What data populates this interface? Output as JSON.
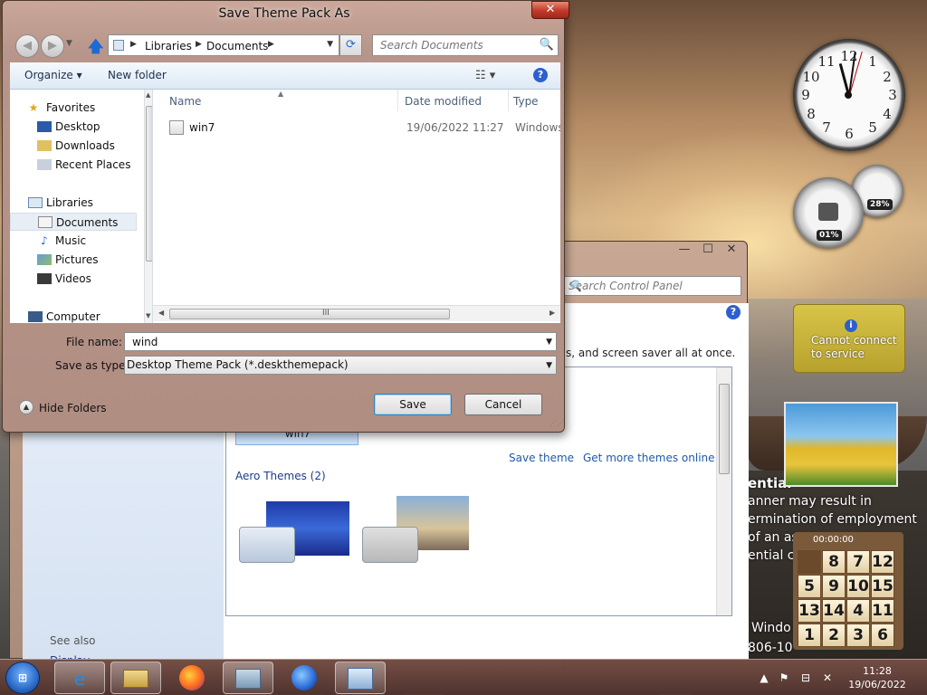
{
  "dialog": {
    "title": "Save Theme Pack As",
    "close_glyph": "✕",
    "back_glyph": "◀",
    "forward_glyph": "▶",
    "dropdown_glyph": "▼",
    "up_glyph": "🡅",
    "address": {
      "crumbs": [
        "Libraries",
        "Documents"
      ],
      "sep": "▶",
      "dd": "▼"
    },
    "refresh_glyph": "⟳",
    "search_placeholder": "Search Documents",
    "search_icon_glyph": "🔍",
    "toolbar": {
      "organize": "Organize ▾",
      "new_folder": "New folder",
      "views": "☷ ▾",
      "help": "?"
    },
    "nav": {
      "favorites": "Favorites",
      "desktop": "Desktop",
      "downloads": "Downloads",
      "recent": "Recent Places",
      "libraries": "Libraries",
      "documents": "Documents",
      "music": "Music",
      "pictures": "Pictures",
      "videos": "Videos",
      "computer": "Computer",
      "scroll_up": "▲",
      "scroll_down": "▼"
    },
    "columns": {
      "name": "Name",
      "date": "Date modified",
      "type": "Type",
      "sort": "▲"
    },
    "files": [
      {
        "name": "win7",
        "date": "19/06/2022 11:27",
        "type": "Windows"
      }
    ],
    "hscroll": {
      "left": "◀",
      "right": "▶",
      "grip": "III"
    },
    "file_name_label": "File name:",
    "file_name_value": "wind",
    "file_name_dd": "▼",
    "save_type_label": "Save as type:",
    "save_type_value": "Desktop Theme Pack (*.deskthemepack)",
    "save_type_dd": "▼",
    "hide_folders": "Hide Folders",
    "hide_folders_glyph": "▲",
    "save_button": "Save",
    "cancel_button": "Cancel",
    "gripper": "⋰⋰"
  },
  "control_panel": {
    "min_glyph": "—",
    "max_glyph": "☐",
    "close_glyph": "✕",
    "search_placeholder": "Search Control Panel",
    "search_icon_glyph": "🔍",
    "help": "?",
    "description": "s, and screen saver all at once.",
    "selected_theme": "win7",
    "save_theme": "Save theme",
    "get_more": "Get more themes online",
    "aero_group": "Aero Themes (2)",
    "see_also": "See also",
    "display": "Display"
  },
  "gadgets": {
    "cpu_pct": "01%",
    "mem_pct": "28%",
    "feed_message": "Cannot connect to service",
    "puzzle_timer": "00:00:00",
    "puzzle_tiles": [
      "",
      "8",
      "7",
      "12",
      "5",
      "9",
      "10",
      "15",
      "13",
      "14",
      "4",
      "11",
      "1",
      "2",
      "3",
      "6"
    ],
    "clock_numbers": [
      "12",
      "1",
      "2",
      "3",
      "4",
      "5",
      "6",
      "7",
      "8",
      "9",
      "10",
      "11"
    ]
  },
  "background_text": [
    "ential",
    "anner may result in",
    "ermination of employment",
    "of an as",
    "ential c",
    "Windo",
    "806-10"
  ],
  "taskbar": {
    "start_glyph": "⊞",
    "time": "11:28",
    "date": "19/06/2022",
    "apps": [
      "ie-icon",
      "explorer-icon",
      "firefox-icon",
      "task-manager-icon",
      "thunderbird-icon",
      "control-panel-icon"
    ]
  }
}
